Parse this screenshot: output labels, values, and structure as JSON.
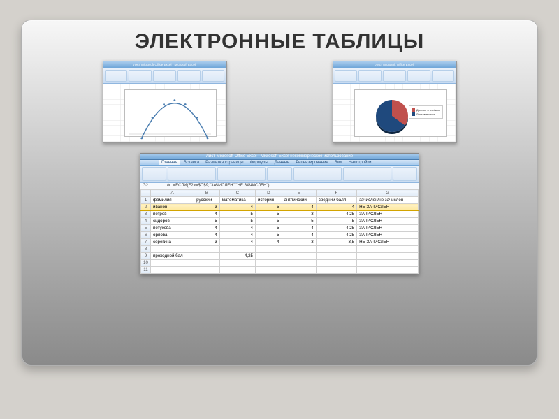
{
  "title": "ЭЛЕКТРОННЫЕ ТАБЛИЦЫ",
  "thumb_left": {
    "titlebar": "Лист Microsoft Office Excel - Microsoft Excel"
  },
  "thumb_right": {
    "titlebar": "Лист Microsoft Office Excel",
    "legend1": "Данные в ячейках",
    "legend2": "Листов в книге"
  },
  "chart_data": [
    {
      "type": "line",
      "title": "",
      "x": [
        -5,
        -4,
        -3,
        -2,
        -1,
        0,
        1,
        2,
        3,
        4,
        5
      ],
      "values": [
        -25,
        -16,
        -9,
        -4,
        -1,
        0,
        -1,
        -4,
        -9,
        -16,
        -25
      ],
      "xlabel": "",
      "ylabel": "",
      "note": "downward parabola y = -x^2 (approximate)"
    },
    {
      "type": "pie",
      "series": [
        {
          "name": "Данные в ячейках",
          "value": 35
        },
        {
          "name": "Листов в книге",
          "value": 65
        }
      ]
    }
  ],
  "big": {
    "titlebar": "Лист Microsoft Office Excel - Microsoft Excel некоммерческое использование",
    "tabs": [
      "Главная",
      "Вставка",
      "Разметка страницы",
      "Формулы",
      "Данные",
      "Рецензирование",
      "Вид",
      "Надстройки"
    ],
    "active_tab": 0,
    "font_name": "Calibri",
    "font_size": "16",
    "cellref": "G2",
    "formula": "=ЕСЛИ(F2>=$C$9;\"ЗАЧИСЛЕН\";\"НЕ ЗАЧИСЛЕН\")",
    "cols": [
      "A",
      "B",
      "C",
      "D",
      "E",
      "F",
      "G"
    ],
    "headers": [
      "фамилия",
      "русский",
      "математика",
      "история",
      "английский",
      "средний балл",
      "зачислен/не зачислен"
    ],
    "selected_row_index": 0,
    "rows": [
      {
        "n": "2",
        "A": "иванов",
        "B": "3",
        "C": "4",
        "D": "5",
        "E": "4",
        "F": "4",
        "G": "НЕ ЗАЧИСЛЕН"
      },
      {
        "n": "3",
        "A": "петров",
        "B": "4",
        "C": "5",
        "D": "5",
        "E": "3",
        "F": "4,25",
        "G": "ЗАЧИСЛЕН"
      },
      {
        "n": "4",
        "A": "сидоров",
        "B": "5",
        "C": "5",
        "D": "5",
        "E": "5",
        "F": "5",
        "G": "ЗАЧИСЛЕН"
      },
      {
        "n": "5",
        "A": "петухова",
        "B": "4",
        "C": "4",
        "D": "5",
        "E": "4",
        "F": "4,25",
        "G": "ЗАЧИСЛЕН"
      },
      {
        "n": "6",
        "A": "орлова",
        "B": "4",
        "C": "4",
        "D": "5",
        "E": "4",
        "F": "4,25",
        "G": "ЗАЧИСЛЕН"
      },
      {
        "n": "7",
        "A": "серегина",
        "B": "3",
        "C": "4",
        "D": "4",
        "E": "3",
        "F": "3,5",
        "G": "НЕ ЗАЧИСЛЕН"
      }
    ],
    "footer": {
      "n": "9",
      "A": "проходной бал",
      "C": "4,25"
    }
  }
}
